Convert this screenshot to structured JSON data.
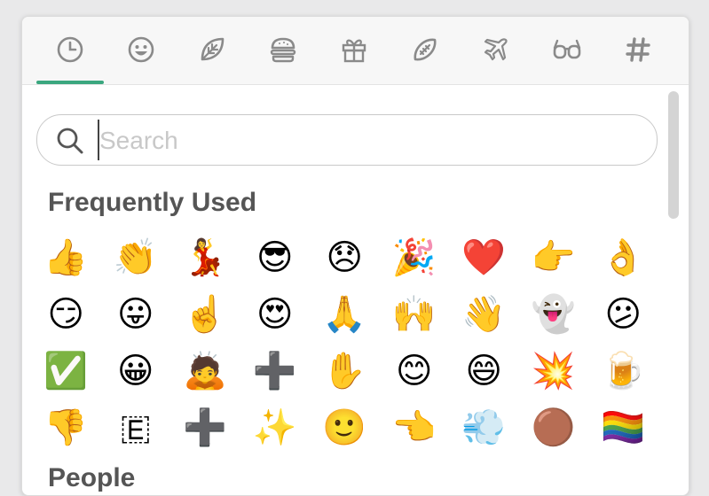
{
  "tabs": [
    {
      "name": "tab-recent",
      "icon": "clock-icon",
      "active": true
    },
    {
      "name": "tab-people",
      "icon": "smiley-icon",
      "active": false
    },
    {
      "name": "tab-nature",
      "icon": "leaf-icon",
      "active": false
    },
    {
      "name": "tab-food",
      "icon": "burger-icon",
      "active": false
    },
    {
      "name": "tab-celebration",
      "icon": "gift-icon",
      "active": false
    },
    {
      "name": "tab-activity",
      "icon": "football-icon",
      "active": false
    },
    {
      "name": "tab-travel",
      "icon": "airplane-icon",
      "active": false
    },
    {
      "name": "tab-objects",
      "icon": "glasses-icon",
      "active": false
    },
    {
      "name": "tab-symbols",
      "icon": "hashtag-icon",
      "active": false
    }
  ],
  "colors": {
    "accent": "#3aa77f",
    "icon": "#8a8a8a",
    "title": "#555555"
  },
  "search": {
    "placeholder": "Search",
    "value": ""
  },
  "sections": {
    "frequently_used": "Frequently Used",
    "next_partial": "People"
  },
  "emojis": [
    [
      "👍",
      "👏",
      "💃",
      "😎",
      "😞",
      "🎉",
      "❤️",
      "👉",
      "👌"
    ],
    [
      "😏",
      "😛",
      "☝️",
      "😍",
      "🙏",
      "🙌",
      "👋",
      "👻",
      "😕"
    ],
    [
      "✅",
      "😀",
      "🙇",
      "➕",
      "✋",
      "😊",
      "😄",
      "💥",
      "🍺"
    ],
    [
      "👎",
      "🇪",
      "➕",
      "✨",
      "🙂",
      "👈",
      "💨",
      "🟤",
      "🏳️‍🌈"
    ]
  ]
}
